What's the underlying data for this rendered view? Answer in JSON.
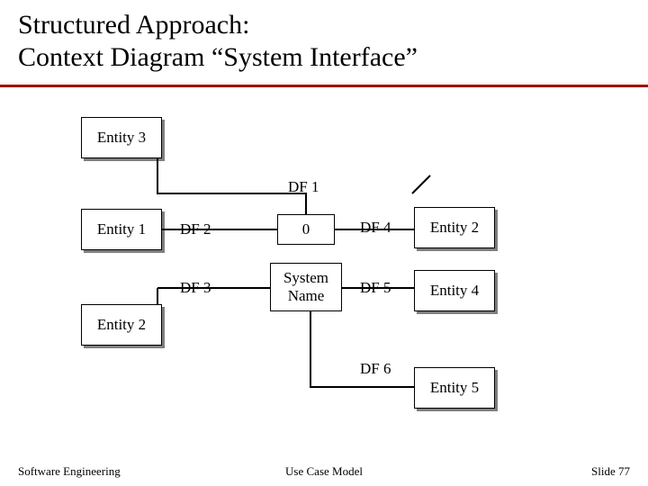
{
  "title_line1": "Structured Approach:",
  "title_line2": "Context Diagram “System Interface”",
  "entities": {
    "e3": "Entity 3",
    "e1": "Entity 1",
    "e2_left": "Entity 2",
    "e2_right": "Entity 2",
    "e4": "Entity 4",
    "e5": "Entity 5"
  },
  "flows": {
    "df1": "DF 1",
    "df2": "DF 2",
    "df3": "DF 3",
    "df4": "DF 4",
    "df5": "DF 5",
    "df6": "DF 6"
  },
  "center": {
    "zero": "0",
    "name": "System\nName"
  },
  "footer": {
    "left": "Software Engineering",
    "center": "Use Case Model",
    "right": "Slide  77"
  }
}
